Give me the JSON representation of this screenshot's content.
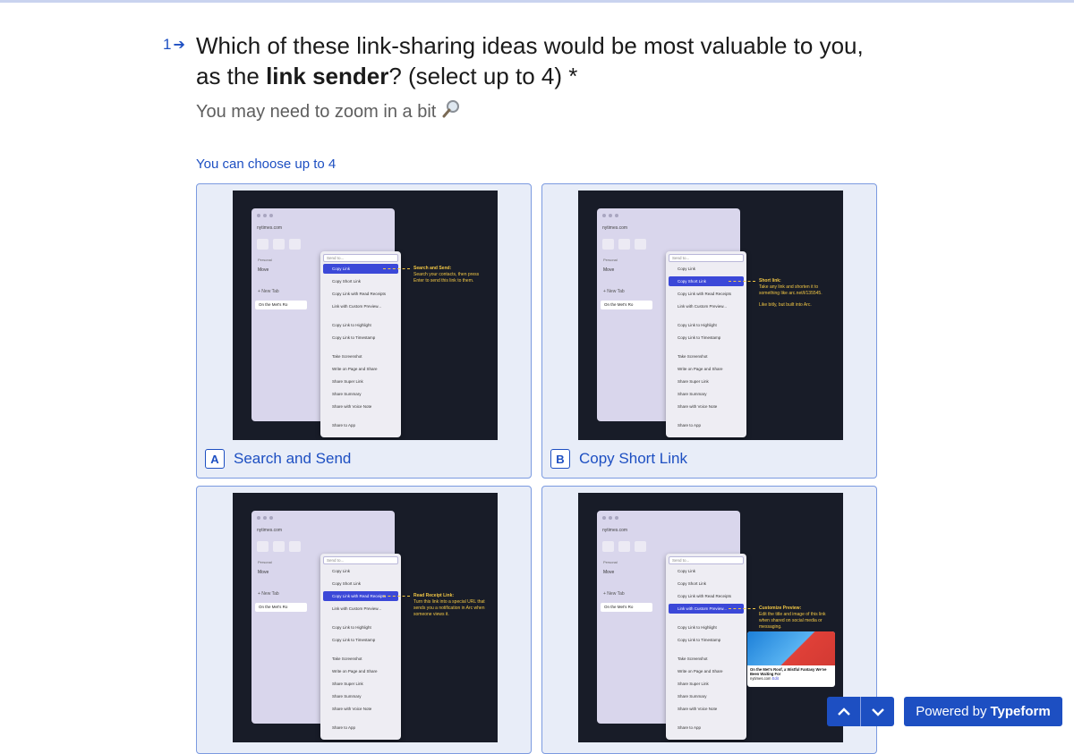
{
  "question": {
    "number": "1",
    "text_before": "Which of these link-sharing ideas would be most valuable to you, as the ",
    "text_bold": "link sender",
    "text_after": "? (select up to 4) *",
    "subtitle": "You may need to zoom in a bit",
    "hint": "You can choose up to 4"
  },
  "mock": {
    "url": "nytimes.com",
    "personal": "Personal",
    "move": "Move",
    "new_tab": "+ New Tab",
    "active_tab": "On the Met's Ro",
    "search_placeholder": "Send to...",
    "menu": [
      "Copy Link",
      "Copy Short Link",
      "Copy Link with Read Receipts",
      "Link with Custom Preview...",
      "Copy Link to Highlight",
      "Copy Link to Timestamp",
      "Take Screenshot",
      "Write on Page and Share",
      "Share Super Link",
      "Share Summary",
      "Share with Voice Note",
      "Share to App"
    ]
  },
  "options": [
    {
      "key": "A",
      "label": "Search and Send",
      "highlight_index": 0,
      "callout_title": "Search and Send:",
      "callout_text": "Search your contacts, then press Enter to send this link to them."
    },
    {
      "key": "B",
      "label": "Copy Short Link",
      "highlight_index": 1,
      "callout_title": "Short link:",
      "callout_text": "Take any link and shorten it to something like arc.net/l/135545.",
      "callout_extra": "Like bitly, but built into Arc."
    },
    {
      "key": "C",
      "label": "",
      "highlight_index": 2,
      "callout_title": "Read Receipt Link:",
      "callout_text": "Turn this link into a special URL that sends you a notification in Arc when someone views it."
    },
    {
      "key": "D",
      "label": "",
      "highlight_index": 3,
      "callout_title": "Customize Preview:",
      "callout_text": "Edit the title and image of this link when shared on social media or messaging.",
      "preview_caption": "On the Met's Roof, a Wistful Fantasy We've Been Waiting For",
      "preview_edit": "Edit",
      "preview_site": "nytimes.com"
    }
  ],
  "footer": {
    "powered_prefix": "Powered by",
    "powered_brand": "Typeform"
  },
  "colors": {
    "accent": "#1d4fc2",
    "card_bg": "#e8edf8",
    "card_border": "#7b9ae0",
    "callout": "#f2c744"
  }
}
